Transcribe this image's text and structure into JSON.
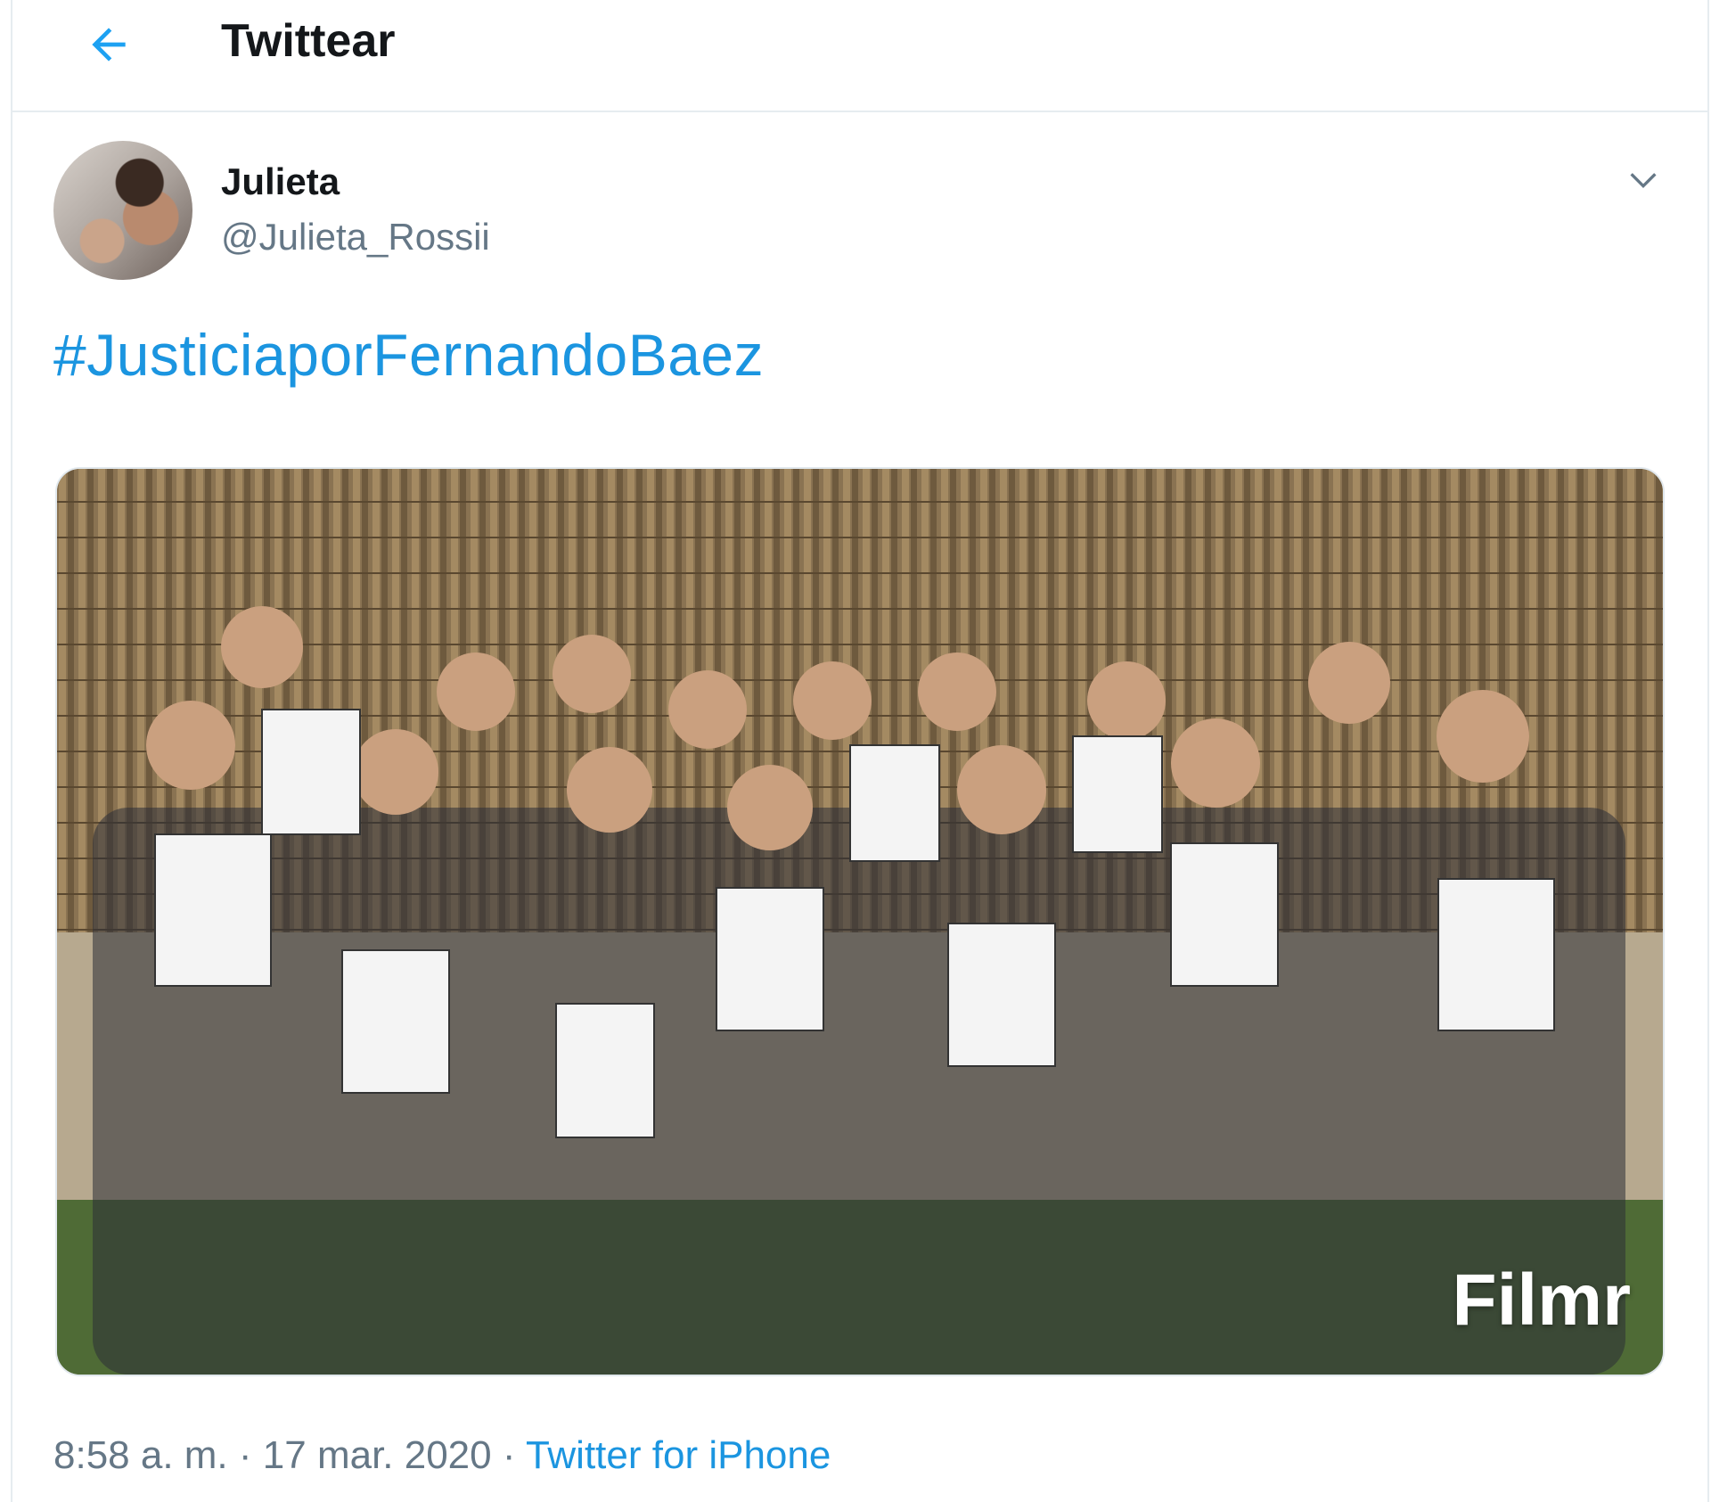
{
  "header": {
    "title": "Twittear",
    "back_icon": "back-arrow-icon"
  },
  "tweet": {
    "author": {
      "display_name": "Julieta",
      "handle": "@Julieta_Rossii"
    },
    "menu_icon": "chevron-down-icon",
    "text": "#JusticiaporFernandoBaez",
    "media": {
      "watermark": "Filmr"
    },
    "meta": {
      "time": "8:58 a. m.",
      "separator": " · ",
      "date": "17 mar. 2020",
      "source": "Twitter for iPhone"
    }
  },
  "colors": {
    "link": "#1b95e0",
    "text": "#14171a",
    "secondary": "#657786",
    "border": "#e6ecf0"
  }
}
